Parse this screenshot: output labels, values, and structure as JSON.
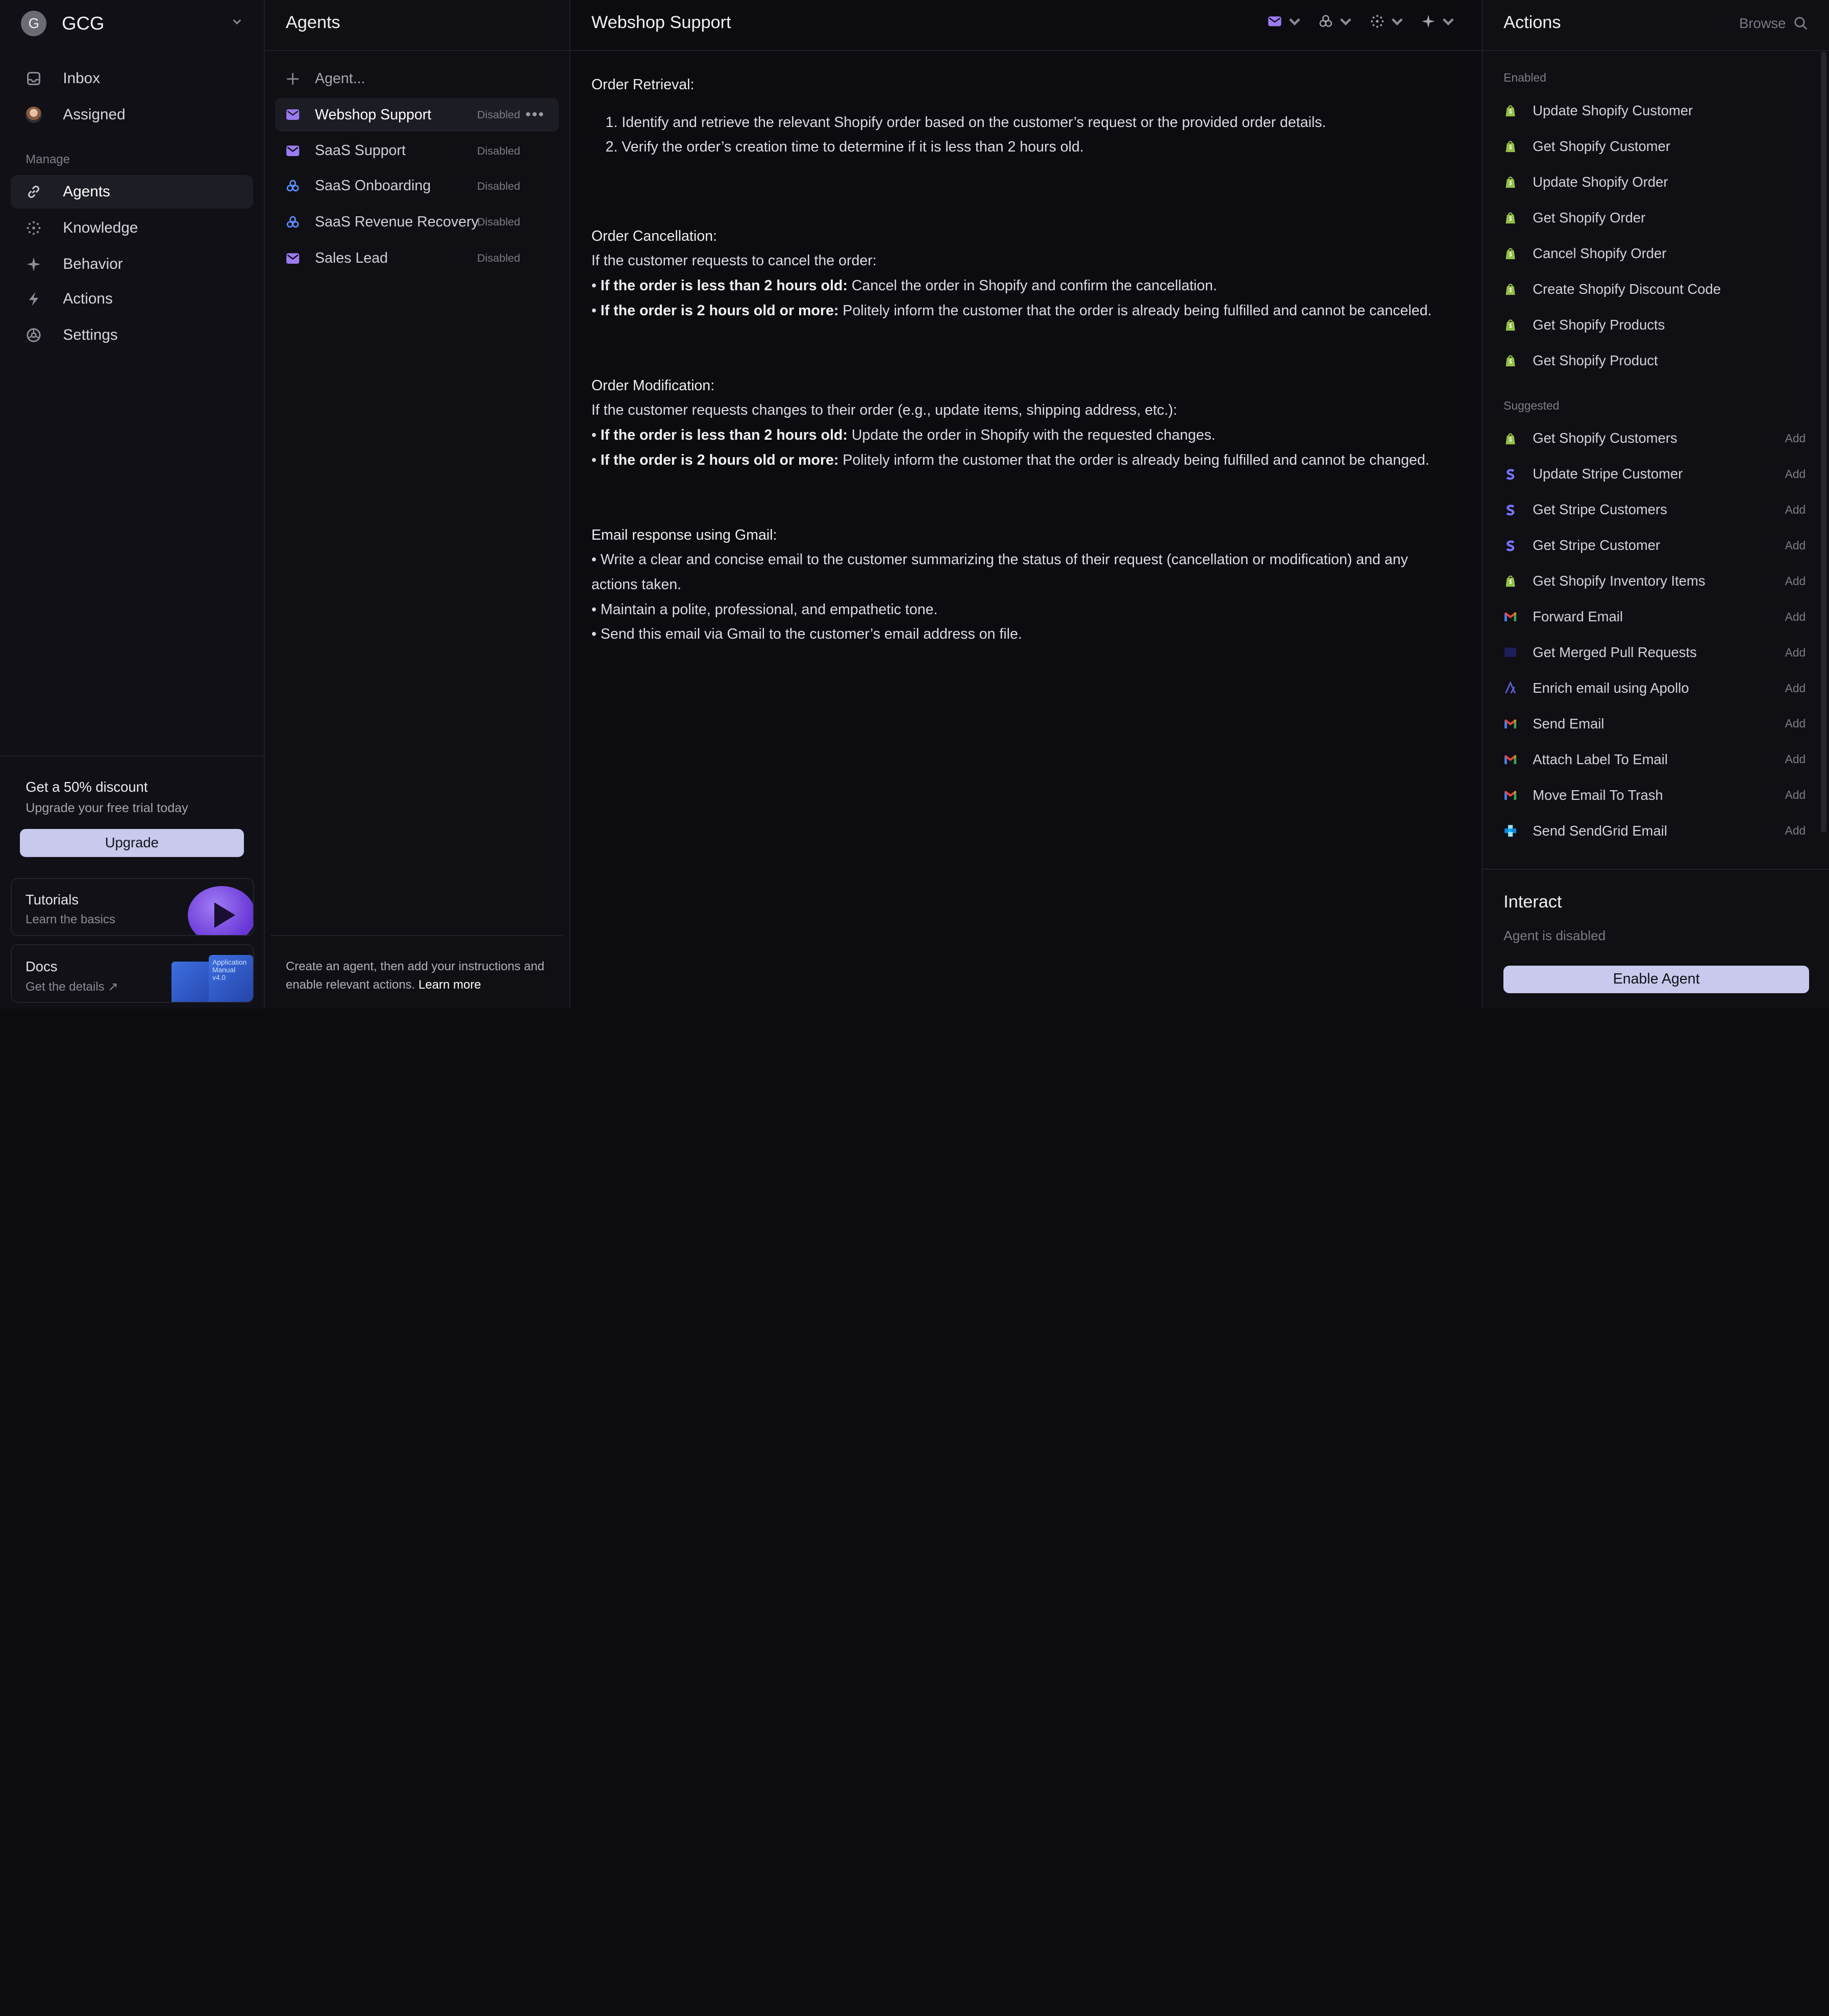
{
  "workspace": {
    "initial": "G",
    "name": "GCG"
  },
  "sidebar": {
    "top": [
      {
        "label": "Inbox",
        "icon": "inbox-icon"
      },
      {
        "label": "Assigned",
        "icon": "avatar"
      }
    ],
    "manage_label": "Manage",
    "manage": [
      {
        "label": "Agents",
        "icon": "link-icon",
        "active": true
      },
      {
        "label": "Knowledge",
        "icon": "dots-circle-icon"
      },
      {
        "label": "Behavior",
        "icon": "sparkle-icon"
      },
      {
        "label": "Actions",
        "icon": "bolt-icon"
      },
      {
        "label": "Settings",
        "icon": "settings-icon"
      }
    ],
    "promo": {
      "title": "Get a 50% discount",
      "subtitle": "Upgrade your free trial today",
      "button": "Upgrade"
    },
    "tutorials": {
      "title": "Tutorials",
      "subtitle": "Learn the basics"
    },
    "docs": {
      "title": "Docs",
      "subtitle": "Get the details ↗",
      "manual_text": "Application Manual v4.0"
    }
  },
  "agents": {
    "title": "Agents",
    "new_placeholder": "Agent...",
    "items": [
      {
        "name": "Webshop Support",
        "status": "Disabled",
        "icon": "mail-icon",
        "active": true
      },
      {
        "name": "SaaS Support",
        "status": "Disabled",
        "icon": "mail-icon"
      },
      {
        "name": "SaaS Onboarding",
        "status": "Disabled",
        "icon": "openai-icon"
      },
      {
        "name": "SaaS Revenue Recovery",
        "status": "Disabled",
        "icon": "openai-icon"
      },
      {
        "name": "Sales Lead",
        "status": "Disabled",
        "icon": "mail-icon"
      }
    ],
    "more": "•••",
    "footer_text": "Create an agent, then add your instructions and enable relevant actions.",
    "footer_link": "Learn more"
  },
  "editor": {
    "title": "Webshop Support",
    "toolbar": [
      "mail-icon",
      "openai-icon",
      "dots-circle-icon",
      "sparkle-icon"
    ],
    "retrieval": {
      "heading": "Order Retrieval:",
      "steps": [
        "Identify and retrieve the relevant Shopify order based on the customer’s request or the provided order details.",
        "Verify the order’s creation time to determine if it is less than 2 hours old."
      ]
    },
    "cancellation": {
      "heading": "Order Cancellation:",
      "intro": "If the customer requests to cancel the order:",
      "b1_bold": "If the order is less than 2 hours old:",
      "b1_text": " Cancel the order in Shopify and confirm the cancellation.",
      "b2_bold": "If the order is 2 hours old or more:",
      "b2_text": " Politely inform the customer that the order is already being fulfilled and cannot be canceled."
    },
    "modification": {
      "heading": "Order Modification:",
      "intro": "If the customer requests changes to their order (e.g., update items, shipping address, etc.):",
      "b1_bold": "If the order is less than 2 hours old:",
      "b1_text": " Update the order in Shopify with the requested changes.",
      "b2_bold": "If the order is 2 hours old or more:",
      "b2_text": " Politely inform the customer that the order is already being fulfilled and cannot be changed."
    },
    "email": {
      "heading": "Email response using Gmail:",
      "bullets": [
        "Write a clear and concise email to the customer summarizing the status of their request (cancellation or modification) and any actions taken.",
        "Maintain a polite, professional, and empathetic tone.",
        "Send this email via Gmail to the customer’s email address on file."
      ]
    }
  },
  "actions": {
    "title": "Actions",
    "browse": "Browse",
    "enabled_label": "Enabled",
    "enabled": [
      {
        "name": "Update Shopify Customer",
        "icon": "shopify-icon"
      },
      {
        "name": "Get Shopify Customer",
        "icon": "shopify-icon"
      },
      {
        "name": "Update Shopify Order",
        "icon": "shopify-icon"
      },
      {
        "name": "Get Shopify Order",
        "icon": "shopify-icon"
      },
      {
        "name": "Cancel Shopify Order",
        "icon": "shopify-icon"
      },
      {
        "name": "Create Shopify Discount Code",
        "icon": "shopify-icon"
      },
      {
        "name": "Get Shopify Products",
        "icon": "shopify-icon"
      },
      {
        "name": "Get Shopify Product",
        "icon": "shopify-icon"
      }
    ],
    "suggested_label": "Suggested",
    "add_label": "Add",
    "suggested": [
      {
        "name": "Get Shopify Customers",
        "icon": "shopify-icon"
      },
      {
        "name": "Update Stripe Customer",
        "icon": "stripe-icon"
      },
      {
        "name": "Get Stripe Customers",
        "icon": "stripe-icon"
      },
      {
        "name": "Get Stripe Customer",
        "icon": "stripe-icon"
      },
      {
        "name": "Get Shopify Inventory Items",
        "icon": "shopify-icon"
      },
      {
        "name": "Forward Email",
        "icon": "gmail-icon"
      },
      {
        "name": "Get Merged Pull Requests",
        "icon": "github-icon"
      },
      {
        "name": "Enrich email using Apollo",
        "icon": "apollo-icon"
      },
      {
        "name": "Send Email",
        "icon": "gmail-icon"
      },
      {
        "name": "Attach Label To Email",
        "icon": "gmail-icon"
      },
      {
        "name": "Move Email To Trash",
        "icon": "gmail-icon"
      },
      {
        "name": "Send SendGrid Email",
        "icon": "sendgrid-icon"
      }
    ],
    "interact_title": "Interact",
    "interact_status": "Agent is disabled",
    "enable_button": "Enable Agent"
  },
  "colors": {
    "background": "#0b0b10",
    "accent": "#c8c9ec",
    "agent_mail": "#9b7bf0",
    "agent_openai": "#5a8cf5",
    "shopify": "#95bf47",
    "stripe": "#635bff"
  }
}
